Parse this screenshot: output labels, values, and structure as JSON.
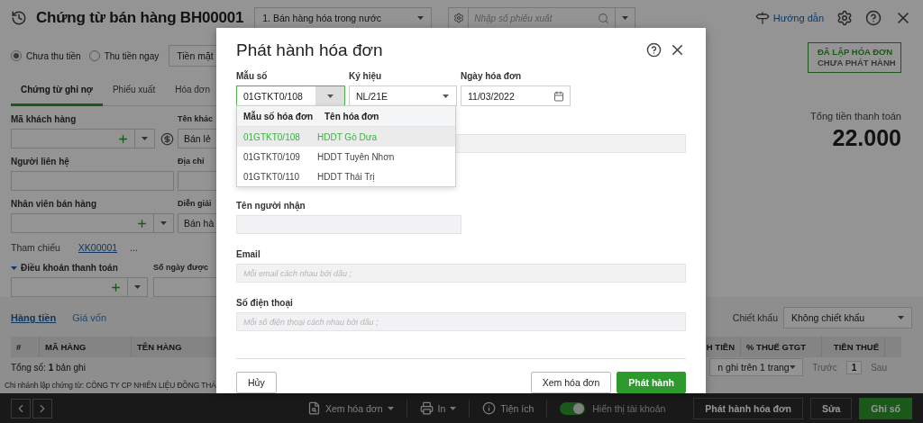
{
  "header": {
    "title": "Chứng từ bán hàng BH00001",
    "type_select": "1. Bán hàng hóa trong nước",
    "search": {
      "placeholder": "Nhập số phiếu xuất"
    },
    "guide_link": "Hướng dẫn"
  },
  "payment": {
    "options": [
      {
        "label": "Chưa thu tiền",
        "selected": true
      },
      {
        "label": "Thu tiền ngay",
        "selected": false
      }
    ],
    "method": "Tiền mặt"
  },
  "tabs": [
    {
      "label": "Chứng từ ghi nợ",
      "selected": true
    },
    {
      "label": "Phiếu xuất",
      "selected": false
    },
    {
      "label": "Hóa đơn",
      "selected": false
    }
  ],
  "form": {
    "left": [
      {
        "label": "Mã khách hàng",
        "kind": "customer"
      },
      {
        "label": "Người liên hệ",
        "kind": "text"
      },
      {
        "label": "Nhân viên bán hàng",
        "kind": "combo"
      }
    ],
    "right": [
      {
        "label": "Tên khác",
        "value": "Bán lẻ"
      },
      {
        "label": "Địa chỉ"
      },
      {
        "label": "Diễn giải",
        "value": "Bán hà"
      }
    ],
    "reference": {
      "label": "Tham chiếu",
      "link": "XK00001",
      "more": "..."
    },
    "terms": {
      "label": "Điều khoản thanh toán",
      "expanded": true
    },
    "days_label": "Số ngày được"
  },
  "status": {
    "line1": "ĐÃ LẬP HÓA ĐƠN",
    "line2": "CHƯA PHÁT HÀNH"
  },
  "total": {
    "label": "Tổng tiền thanh toán",
    "value": "22.000"
  },
  "detail": {
    "tabs": [
      {
        "label": "Hàng tiền",
        "selected": true
      },
      {
        "label": "Giá vốn",
        "selected": false
      }
    ],
    "discount": {
      "label": "Chiết khấu",
      "value": "Không chiết khấu"
    },
    "columns_left": [
      "#",
      "MÃ HÀNG",
      "TÊN HÀNG"
    ],
    "columns_right": [
      "H TIỀN",
      "% THUẾ GTGT",
      "TIỀN THUẾ"
    ],
    "record_count": "Tổng số: **1** bản ghi",
    "page_size": "n ghi trên 1 trang",
    "prev": "Trước",
    "page": "1",
    "next": "Sau"
  },
  "branch": "Chi nhánh lập chứng từ: CÔNG TY CP NHIÊN LIỆU ĐỒNG THÁ",
  "footer": {
    "view_invoice": "Xem hóa đơn",
    "print": "In",
    "utilities": "Tiện ích",
    "show_accounts": {
      "label": "Hiển thị tài khoản",
      "on": true
    },
    "buttons": [
      {
        "label": "Phát hành hóa đơn",
        "kind": "secondary"
      },
      {
        "label": "Sửa",
        "kind": "secondary"
      },
      {
        "label": "Ghi sổ",
        "kind": "primary"
      }
    ]
  },
  "dialog": {
    "title": "Phát hành hóa đơn",
    "template": {
      "label": "Mẫu số",
      "value": "01GTKT0/108",
      "focused": true
    },
    "symbol": {
      "label": "Ký hiệu",
      "value": "NL/21E"
    },
    "date": {
      "label": "Ngày hóa đơn",
      "value": "11/03/2022"
    },
    "dropdown": {
      "columns": [
        "Mẫu số hóa đơn",
        "Tên hóa đơn"
      ],
      "rows": [
        {
          "code": "01GTKT0/108",
          "name": "HDDT Gò Dưa",
          "selected": true
        },
        {
          "code": "01GTKT0/109",
          "name": "HDDT Tuyên Nhơn",
          "selected": false
        },
        {
          "code": "01GTKT0/110",
          "name": "HDDT Thái Trị",
          "selected": false
        }
      ]
    },
    "recipient": {
      "label": "Tên người nhận"
    },
    "email": {
      "label": "Email",
      "placeholder": "Mỗi email cách nhau bởi dấu ;"
    },
    "phone": {
      "label": "Số điện thoại",
      "placeholder": "Mỗi số điện thoại cách nhau bởi dấu ;"
    },
    "buttons": [
      {
        "label": "Hủy",
        "kind": "cancel"
      },
      {
        "label": "Xem hóa đơn",
        "kind": "secondary"
      },
      {
        "label": "Phát hành",
        "kind": "primary"
      }
    ]
  }
}
